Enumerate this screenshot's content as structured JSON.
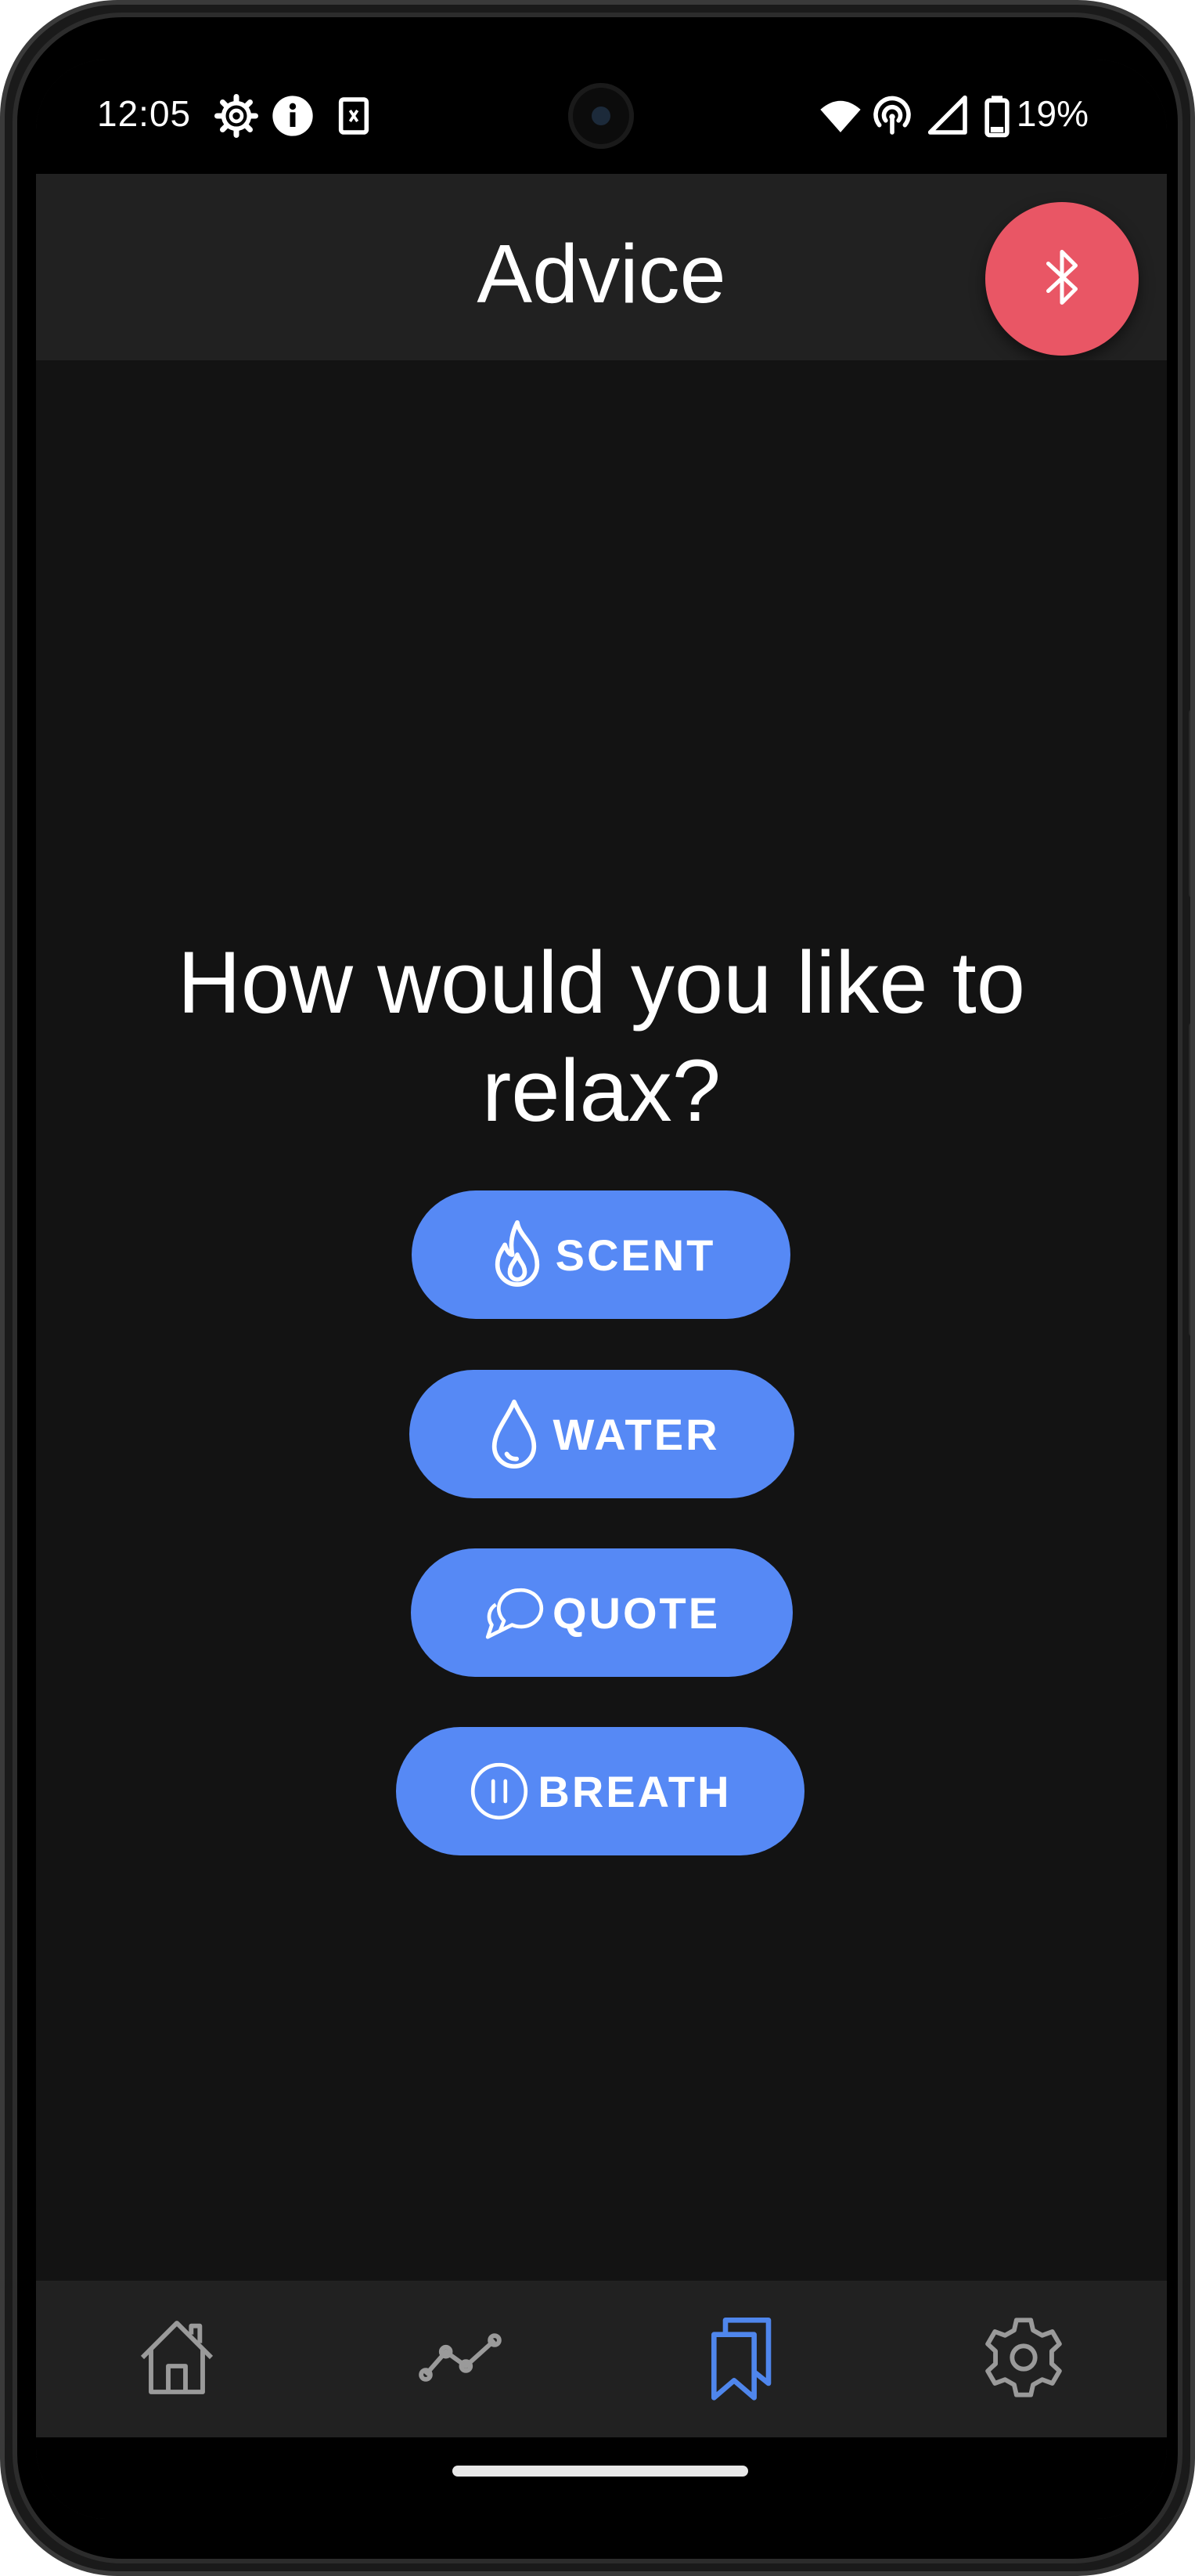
{
  "status_bar": {
    "time": "12:05",
    "battery_percent": "19%",
    "left_icons": [
      "gear-icon",
      "info-icon",
      "sim-icon"
    ],
    "right_icons": [
      "wifi-icon",
      "hotspot-icon",
      "cell-signal-icon",
      "battery-icon"
    ]
  },
  "app_bar": {
    "title": "Advice",
    "fab_icon": "bluetooth-icon",
    "fab_color": "#e95665"
  },
  "main": {
    "question": "How would you like to relax?",
    "accent_color": "#5689f5",
    "options": [
      {
        "label": "SCENT",
        "icon": "flame-icon"
      },
      {
        "label": "WATER",
        "icon": "water-drop-icon"
      },
      {
        "label": "QUOTE",
        "icon": "chat-bubbles-icon"
      },
      {
        "label": "BREATH",
        "icon": "pause-circle-icon"
      }
    ]
  },
  "bottom_nav": {
    "items": [
      {
        "icon": "home-icon",
        "active": false
      },
      {
        "icon": "trend-chart-icon",
        "active": false
      },
      {
        "icon": "bookmarks-icon",
        "active": true
      },
      {
        "icon": "settings-gear-icon",
        "active": false
      }
    ],
    "active_color": "#4f86ec",
    "inactive_color": "#9a9a9a"
  }
}
